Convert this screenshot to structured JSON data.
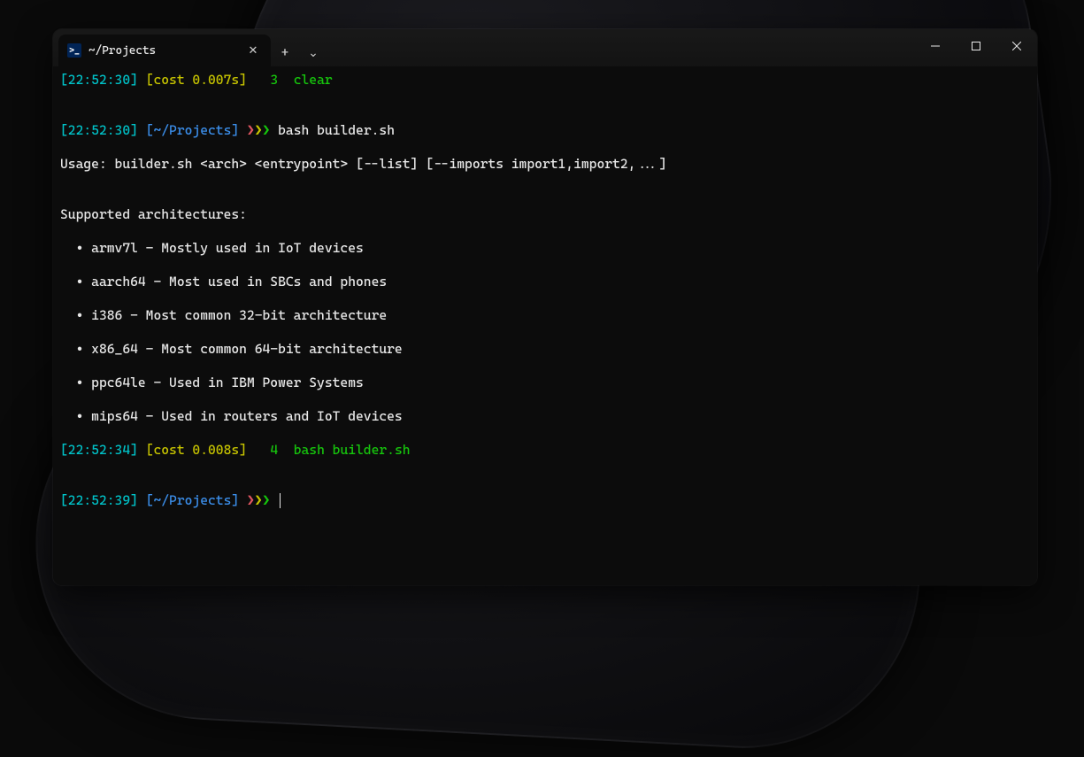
{
  "window": {
    "tab_title": "~/Projects"
  },
  "lines": {
    "l1_time": "[22:52:30]",
    "l1_cost": "[cost 0.007s]",
    "l1_num": "3",
    "l1_cmd": "clear",
    "l2_time": "[22:52:30]",
    "l2_path": "[~/Projects]",
    "l2_cmd": "bash builder.sh",
    "usage": "Usage: builder.sh <arch> <entrypoint> [--list] [--imports import1,import2,...]",
    "arch_header": "Supported architectures:",
    "arch1": "  • armv7l - Mostly used in IoT devices",
    "arch2": "  • aarch64 - Most used in SBCs and phones",
    "arch3": "  • i386 - Most common 32-bit architecture",
    "arch4": "  • x86_64 - Most common 64-bit architecture",
    "arch5": "  • ppc64le - Used in IBM Power Systems",
    "arch6": "  • mips64 - Used in routers and IoT devices",
    "l3_time": "[22:52:34]",
    "l3_cost": "[cost 0.008s]",
    "l3_num": "4",
    "l3_cmd": "bash builder.sh",
    "l4_time": "[22:52:39]",
    "l4_path": "[~/Projects]"
  },
  "glyphs": {
    "prompt_r": "❯",
    "prompt_y": "❯",
    "prompt_g": "❯",
    "plus": "+",
    "chevron": "⌄",
    "close": "✕",
    "ps_icon": ">_"
  }
}
